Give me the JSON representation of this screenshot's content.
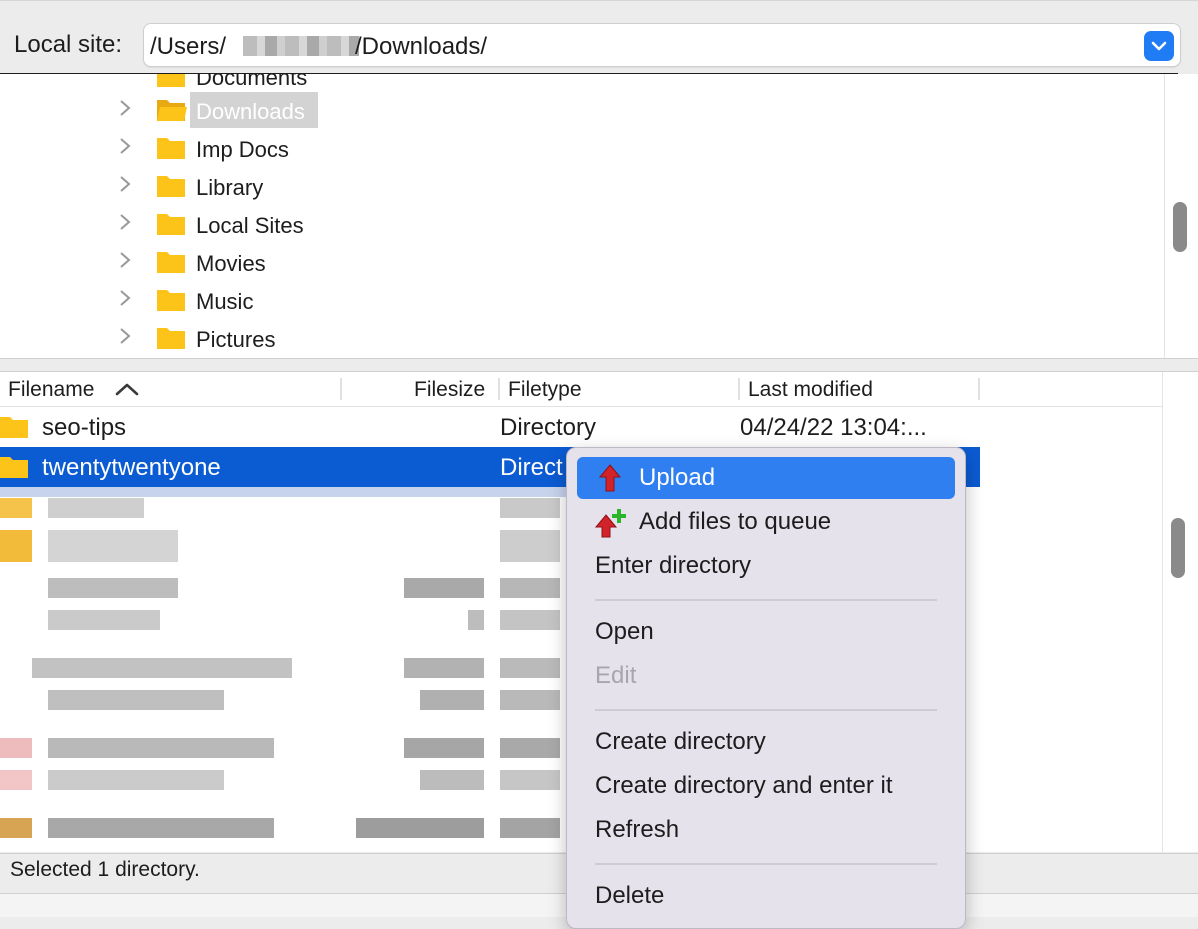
{
  "local_site": {
    "label": "Local site:",
    "path_prefix": "/Users/",
    "path_suffix": "/Downloads/",
    "dropdown_icon": "chevron-down-icon"
  },
  "tree": {
    "partial_item": "Documents",
    "items": [
      {
        "label": "Downloads",
        "selected": true
      },
      {
        "label": "Imp Docs"
      },
      {
        "label": "Library"
      },
      {
        "label": "Local Sites"
      },
      {
        "label": "Movies"
      },
      {
        "label": "Music"
      },
      {
        "label": "Pictures"
      }
    ]
  },
  "file_list": {
    "columns": {
      "filename": "Filename",
      "filesize": "Filesize",
      "filetype": "Filetype",
      "last_modified": "Last modified"
    },
    "sort_icon": "sort-ascending-chevron-icon",
    "rows": [
      {
        "name": "seo-tips",
        "type": "Directory",
        "modified": "04/24/22 13:04:..."
      },
      {
        "name": "twentytwentyone",
        "type": "Direct",
        "selected": true
      }
    ]
  },
  "status": {
    "text": "Selected 1 directory."
  },
  "context_menu": {
    "items": {
      "upload": "Upload",
      "add_to_queue": "Add files to queue",
      "enter_directory": "Enter directory",
      "open": "Open",
      "edit": "Edit",
      "create_directory": "Create directory",
      "create_directory_enter": "Create directory and enter it",
      "refresh": "Refresh",
      "delete": "Delete"
    },
    "highlighted": "Upload",
    "disabled": [
      "Edit"
    ]
  },
  "colors": {
    "selection": "#0b5bd3",
    "menu_highlight": "#2f7ff0",
    "folder": "#fcc419",
    "accent": "#1f7cf4"
  }
}
